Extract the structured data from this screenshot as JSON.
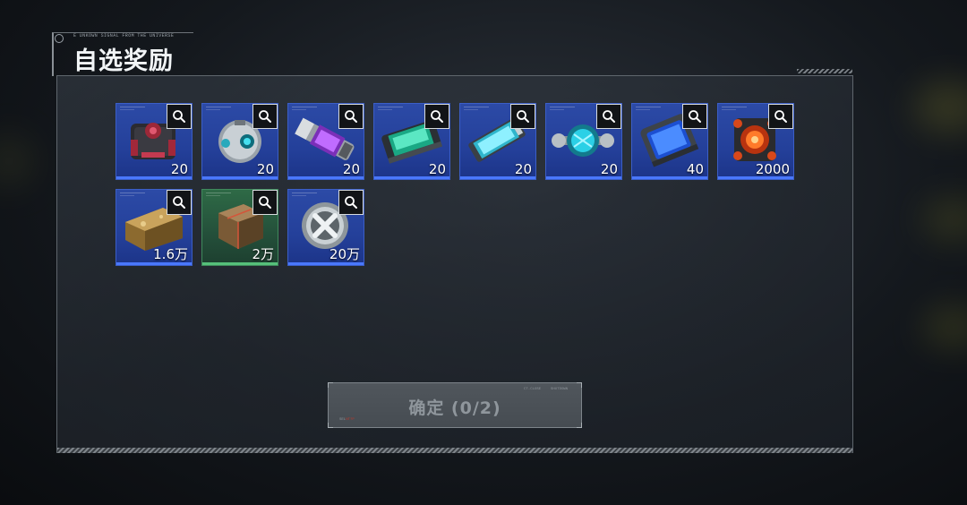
{
  "header": {
    "subtitle": "E UNKOWN SIGNAL FROM THE UNIVERSE",
    "title": "自选奖励"
  },
  "rewards": [
    {
      "icon": "red-black-core-module",
      "quantity": "20",
      "rarity": "blue"
    },
    {
      "icon": "spherical-drone-core",
      "quantity": "20",
      "rarity": "blue"
    },
    {
      "icon": "purple-energy-cylinder",
      "quantity": "20",
      "rarity": "blue"
    },
    {
      "icon": "teal-energy-cell",
      "quantity": "20",
      "rarity": "blue"
    },
    {
      "icon": "cyan-data-chip",
      "quantity": "20",
      "rarity": "blue"
    },
    {
      "icon": "cyan-orb-connector",
      "quantity": "20",
      "rarity": "blue"
    },
    {
      "icon": "blue-screen-tablet",
      "quantity": "40",
      "rarity": "blue"
    },
    {
      "icon": "orange-glowing-cube",
      "quantity": "2000",
      "rarity": "blue"
    },
    {
      "icon": "gold-ore-ingot",
      "quantity": "1.6万",
      "rarity": "blue"
    },
    {
      "icon": "bronze-alloy-block",
      "quantity": "2万",
      "rarity": "green"
    },
    {
      "icon": "silver-x-coin",
      "quantity": "20万",
      "rarity": "blue"
    }
  ],
  "confirm_button": {
    "label": "确定 (0/2)",
    "tiny_left": "SEL",
    "tiny_left_red": "NT?P",
    "tiny_right1": "CT-CLOSE",
    "tiny_right2": "SHUTDOWN"
  },
  "colors": {
    "rarity_blue": "#2c4aa6",
    "rarity_green": "#2e6a46",
    "panel_border": "#5f666d",
    "button_bg": "#4b5157"
  }
}
